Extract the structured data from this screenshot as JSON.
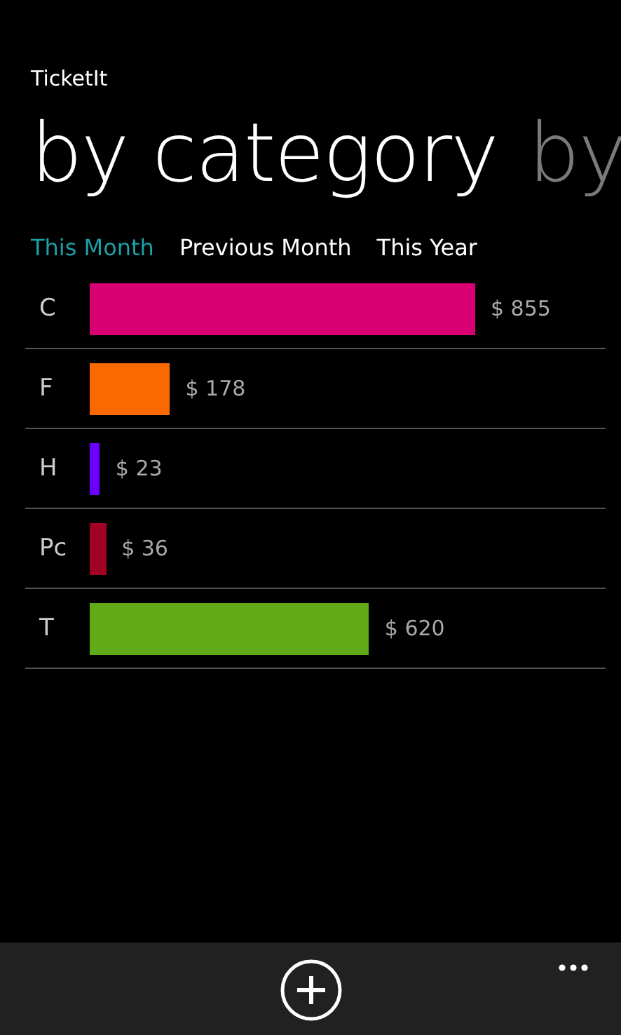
{
  "app_title": "TicketIt",
  "pivot_headers": [
    {
      "label": "by category",
      "selected": true
    },
    {
      "label": "by",
      "selected": false
    }
  ],
  "period_tabs": [
    {
      "label": "This Month",
      "selected": true
    },
    {
      "label": "Previous Month",
      "selected": false
    },
    {
      "label": "This Year",
      "selected": false
    }
  ],
  "categories": [
    {
      "name": "C",
      "amount": "$ 855",
      "color": "#d80073"
    },
    {
      "name": "F",
      "amount": "$ 178",
      "color": "#fa6800"
    },
    {
      "name": "H",
      "amount": "$ 23",
      "color": "#6a00ff"
    },
    {
      "name": "Pc",
      "amount": "$ 36",
      "color": "#a20025"
    },
    {
      "name": "T",
      "amount": "$ 620",
      "color": "#60a917"
    }
  ]
}
